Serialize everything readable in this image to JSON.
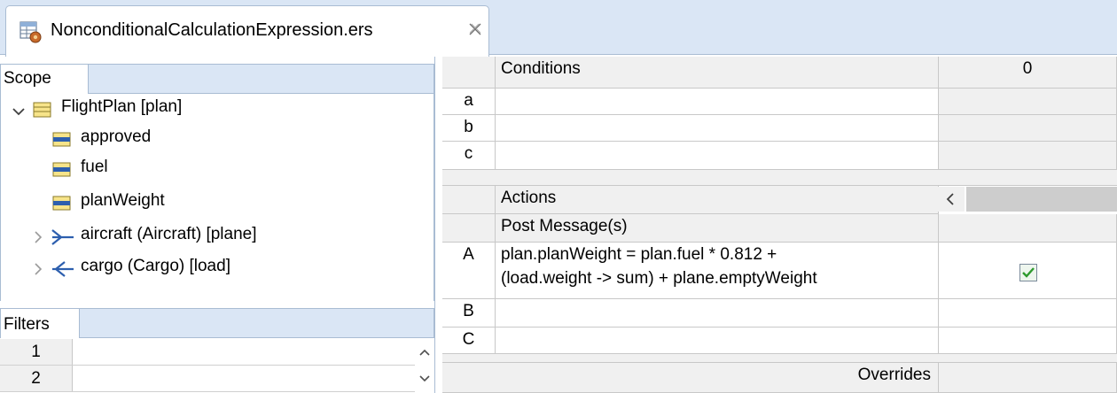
{
  "tab": {
    "title": "NonconditionalCalculationExpression.ers",
    "icon": "ruleset-file-icon",
    "close_icon": "close-icon"
  },
  "scope": {
    "header": "Scope",
    "tree": [
      {
        "label": "FlightPlan [plan]",
        "icon": "entity-icon",
        "expanded": true
      },
      {
        "label": "approved",
        "icon": "attribute-icon"
      },
      {
        "label": "fuel",
        "icon": "attribute-icon"
      },
      {
        "label": "planWeight",
        "icon": "attribute-icon"
      },
      {
        "label": "aircraft (Aircraft) [plane]",
        "icon": "association-outgoing-icon",
        "expanded": false
      },
      {
        "label": "cargo (Cargo) [load]",
        "icon": "association-incoming-icon",
        "expanded": false
      }
    ]
  },
  "filters": {
    "header": "Filters",
    "rows": [
      "1",
      "2"
    ]
  },
  "conditions": {
    "header": "Conditions",
    "column_header": "0",
    "rows": [
      "a",
      "b",
      "c"
    ]
  },
  "actions": {
    "header": "Actions",
    "post_message_label": "Post Message(s)",
    "rows": [
      {
        "id": "A",
        "line1": "plan.planWeight = plan.fuel * 0.812 +",
        "line2": "(load.weight -> sum) + plane.emptyWeight",
        "checked": true
      },
      {
        "id": "B"
      },
      {
        "id": "C"
      }
    ],
    "overrides_label": "Overrides"
  },
  "colors": {
    "tab_strip": "#dae6f5",
    "border": "#a9bcd3",
    "checkmark": "#2e9a2e"
  }
}
